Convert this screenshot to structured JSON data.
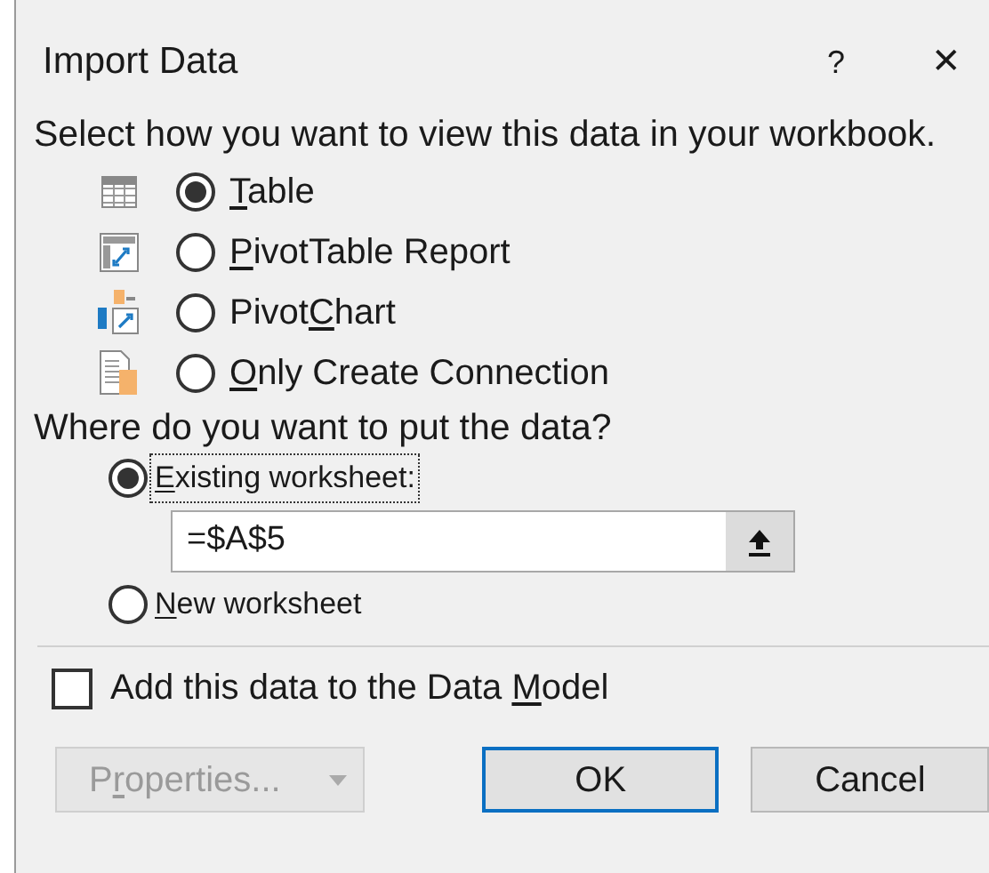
{
  "window": {
    "title": "Import Data",
    "help_glyph": "?",
    "close_glyph": "✕"
  },
  "view_prompt": "Select how you want to view this data in your workbook.",
  "view_options": [
    {
      "kind": "table",
      "selected": true,
      "label": [
        {
          "text": "T",
          "underline": true
        },
        {
          "text": "able",
          "underline": false
        }
      ]
    },
    {
      "kind": "pivottable",
      "selected": false,
      "label": [
        {
          "text": "P",
          "underline": true
        },
        {
          "text": "ivotTable Report",
          "underline": false
        }
      ]
    },
    {
      "kind": "pivotchart",
      "selected": false,
      "label": [
        {
          "text": "Pivot",
          "underline": false
        },
        {
          "text": "C",
          "underline": true
        },
        {
          "text": "hart",
          "underline": false
        }
      ]
    },
    {
      "kind": "connection",
      "selected": false,
      "label": [
        {
          "text": "O",
          "underline": true
        },
        {
          "text": "nly Create Connection",
          "underline": false
        }
      ]
    }
  ],
  "location_prompt": "Where do you want to put the data?",
  "location_options": [
    {
      "selected": true,
      "focused": true,
      "label": [
        {
          "text": "E",
          "underline": true
        },
        {
          "text": "xisting worksheet:",
          "underline": false
        }
      ],
      "value": "=$A$5"
    },
    {
      "selected": false,
      "focused": false,
      "label": [
        {
          "text": "N",
          "underline": true
        },
        {
          "text": "ew worksheet",
          "underline": false
        }
      ]
    }
  ],
  "data_model": {
    "checked": false,
    "label": [
      {
        "text": "Add this data to the Data ",
        "underline": false
      },
      {
        "text": "M",
        "underline": true
      },
      {
        "text": "odel",
        "underline": false
      }
    ]
  },
  "buttons": [
    {
      "kind": "dropdown",
      "disabled": true,
      "default": false,
      "label": [
        {
          "text": "P",
          "underline": false
        },
        {
          "text": "r",
          "underline": true
        },
        {
          "text": "operties...",
          "underline": false
        }
      ]
    },
    {
      "kind": "plain",
      "disabled": false,
      "default": true,
      "label": [
        {
          "text": "OK",
          "underline": false
        }
      ]
    },
    {
      "kind": "plain",
      "disabled": false,
      "default": false,
      "label": [
        {
          "text": "Cancel",
          "underline": false
        }
      ]
    }
  ]
}
